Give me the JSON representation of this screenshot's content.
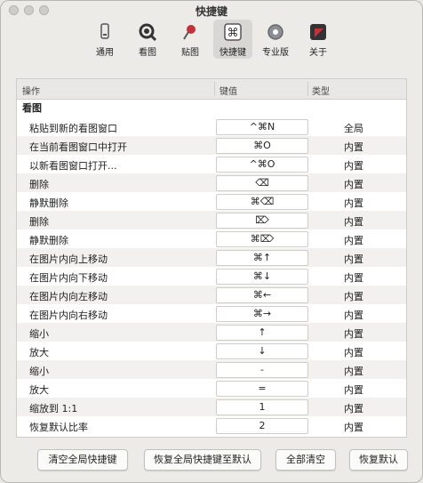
{
  "window": {
    "title": "快捷键"
  },
  "toolbar": [
    {
      "label": "通用",
      "icon": "phone-icon"
    },
    {
      "label": "看图",
      "icon": "magnifier-icon"
    },
    {
      "label": "贴图",
      "icon": "pin-icon"
    },
    {
      "label": "快捷键",
      "icon": "command-icon"
    },
    {
      "label": "专业版",
      "icon": "gear-icon"
    },
    {
      "label": "关于",
      "icon": "app-icon"
    }
  ],
  "table": {
    "headers": [
      "操作",
      "键值",
      "类型"
    ],
    "section": "看图",
    "rows": [
      {
        "action": "粘贴到新的看图窗口",
        "key": "^⌘N",
        "type": "全局"
      },
      {
        "action": "在当前看图窗口中打开",
        "key": "⌘O",
        "type": "内置"
      },
      {
        "action": "以新看图窗口打开...",
        "key": "^⌘O",
        "type": "内置"
      },
      {
        "action": "删除",
        "key": "⌫",
        "type": "内置"
      },
      {
        "action": "静默删除",
        "key": "⌘⌫",
        "type": "内置"
      },
      {
        "action": "删除",
        "key": "⌦",
        "type": "内置"
      },
      {
        "action": "静默删除",
        "key": "⌘⌦",
        "type": "内置"
      },
      {
        "action": "在图片内向上移动",
        "key": "⌘↑",
        "type": "内置"
      },
      {
        "action": "在图片内向下移动",
        "key": "⌘↓",
        "type": "内置"
      },
      {
        "action": "在图片内向左移动",
        "key": "⌘←",
        "type": "内置"
      },
      {
        "action": "在图片内向右移动",
        "key": "⌘→",
        "type": "内置"
      },
      {
        "action": "缩小",
        "key": "↑",
        "type": "内置"
      },
      {
        "action": "放大",
        "key": "↓",
        "type": "内置"
      },
      {
        "action": "缩小",
        "key": "-",
        "type": "内置"
      },
      {
        "action": "放大",
        "key": "=",
        "type": "内置"
      },
      {
        "action": "缩放到 1:1",
        "key": "1",
        "type": "内置"
      },
      {
        "action": "恢复默认比率",
        "key": "2",
        "type": "内置"
      }
    ]
  },
  "buttons": {
    "clear_global": "清空全局快捷键",
    "restore_global": "恢复全局快捷键至默认",
    "clear_all": "全部清空",
    "restore_default": "恢复默认"
  }
}
